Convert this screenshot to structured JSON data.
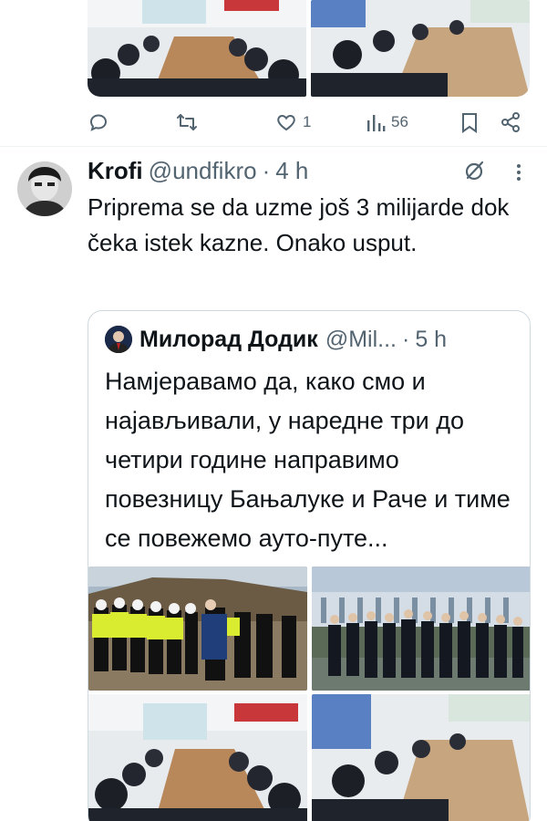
{
  "previous_tweet": {
    "actions": {
      "reply_count": "",
      "retweet_count": "",
      "like_count": "1",
      "views_count": "56"
    }
  },
  "tweet": {
    "display_name": "Krofi",
    "handle": "@undfikro",
    "separator": "·",
    "time": "4 h",
    "text": "Priprema se da uzme još 3 milijarde dok čeka istek kazne. Onako usput."
  },
  "quote": {
    "display_name": "Милорад Додик",
    "handle": "@Mil...",
    "separator": "·",
    "time": "5 h",
    "text": "Намјеравамо да, како смо и најављивали, у наредне три до четири године направимо повезницу Бањалуке и Раче и тиме се повежемо ауто-путе..."
  },
  "icons": {
    "reply": "reply-icon",
    "retweet": "retweet-icon",
    "like": "heart-icon",
    "views": "bar-chart-icon",
    "bookmark": "bookmark-icon",
    "share": "share-icon",
    "grok": "grok-icon",
    "more": "more-dots-icon"
  },
  "colors": {
    "text_primary": "#0f1419",
    "text_secondary": "#536471",
    "border": "#cfd9de"
  }
}
